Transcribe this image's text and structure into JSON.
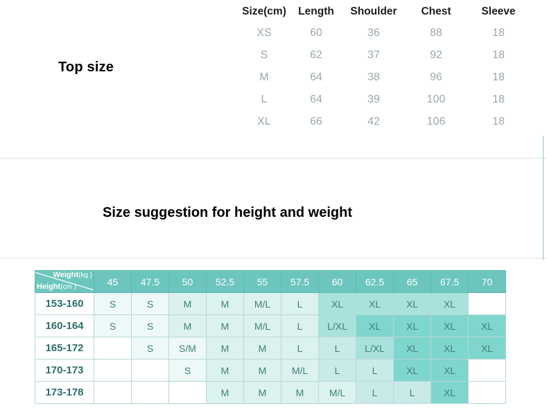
{
  "top_section": {
    "label": "Top size",
    "table": {
      "headers": [
        "Size(cm)",
        "Length",
        "Shoulder",
        "Chest",
        "Sleeve"
      ],
      "rows": [
        [
          "XS",
          "60",
          "36",
          "88",
          "18"
        ],
        [
          "S",
          "62",
          "37",
          "92",
          "18"
        ],
        [
          "M",
          "64",
          "38",
          "96",
          "18"
        ],
        [
          "L",
          "64",
          "39",
          "100",
          "18"
        ],
        [
          "XL",
          "66",
          "42",
          "106",
          "18"
        ]
      ]
    }
  },
  "suggestion": {
    "heading": "Size suggestion for height and weight",
    "corner": {
      "weight_label": "Weight",
      "weight_unit": "(kg )",
      "height_label": "Height",
      "height_unit": "(cm )"
    },
    "weight_headers": [
      "45",
      "47.5",
      "50",
      "52.5",
      "55",
      "57.5",
      "60",
      "62.5",
      "65",
      "67.5",
      "70"
    ],
    "height_rows": [
      "153-160",
      "160-164",
      "165-172",
      "170-173",
      "173-178"
    ],
    "cells": [
      [
        "S",
        "S",
        "M",
        "M",
        "M/L",
        "L",
        "XL",
        "XL",
        "XL",
        "XL",
        ""
      ],
      [
        "S",
        "S",
        "M",
        "M",
        "M/L",
        "L",
        "L/XL",
        "XL",
        "XL",
        "XL",
        "XL"
      ],
      [
        "",
        "S",
        "S/M",
        "M",
        "M",
        "L",
        "L",
        "L/XL",
        "XL",
        "XL",
        "XL"
      ],
      [
        "",
        "",
        "S",
        "M",
        "M",
        "M/L",
        "L",
        "L",
        "XL",
        "XL",
        ""
      ],
      [
        "",
        "",
        "",
        "M",
        "M",
        "M",
        "M/L",
        "L",
        "L",
        "XL",
        ""
      ]
    ],
    "shade_levels": [
      [
        1,
        1,
        2,
        2,
        2,
        2,
        4,
        4,
        4,
        4,
        0
      ],
      [
        1,
        1,
        2,
        2,
        2,
        2,
        4,
        5,
        5,
        5,
        5
      ],
      [
        0,
        1,
        1,
        2,
        2,
        2,
        3,
        4,
        5,
        5,
        5
      ],
      [
        0,
        0,
        1,
        2,
        2,
        2,
        3,
        3,
        5,
        5,
        0
      ],
      [
        0,
        0,
        0,
        2,
        2,
        2,
        2,
        3,
        3,
        5,
        0
      ]
    ]
  },
  "colors": {
    "header_teal": "#6cc6bd",
    "cell_border": "#b8d8d4",
    "value_text": "#3f7f78",
    "top_table_value": "#9aa9a8",
    "divider": "#dfe5e5"
  }
}
